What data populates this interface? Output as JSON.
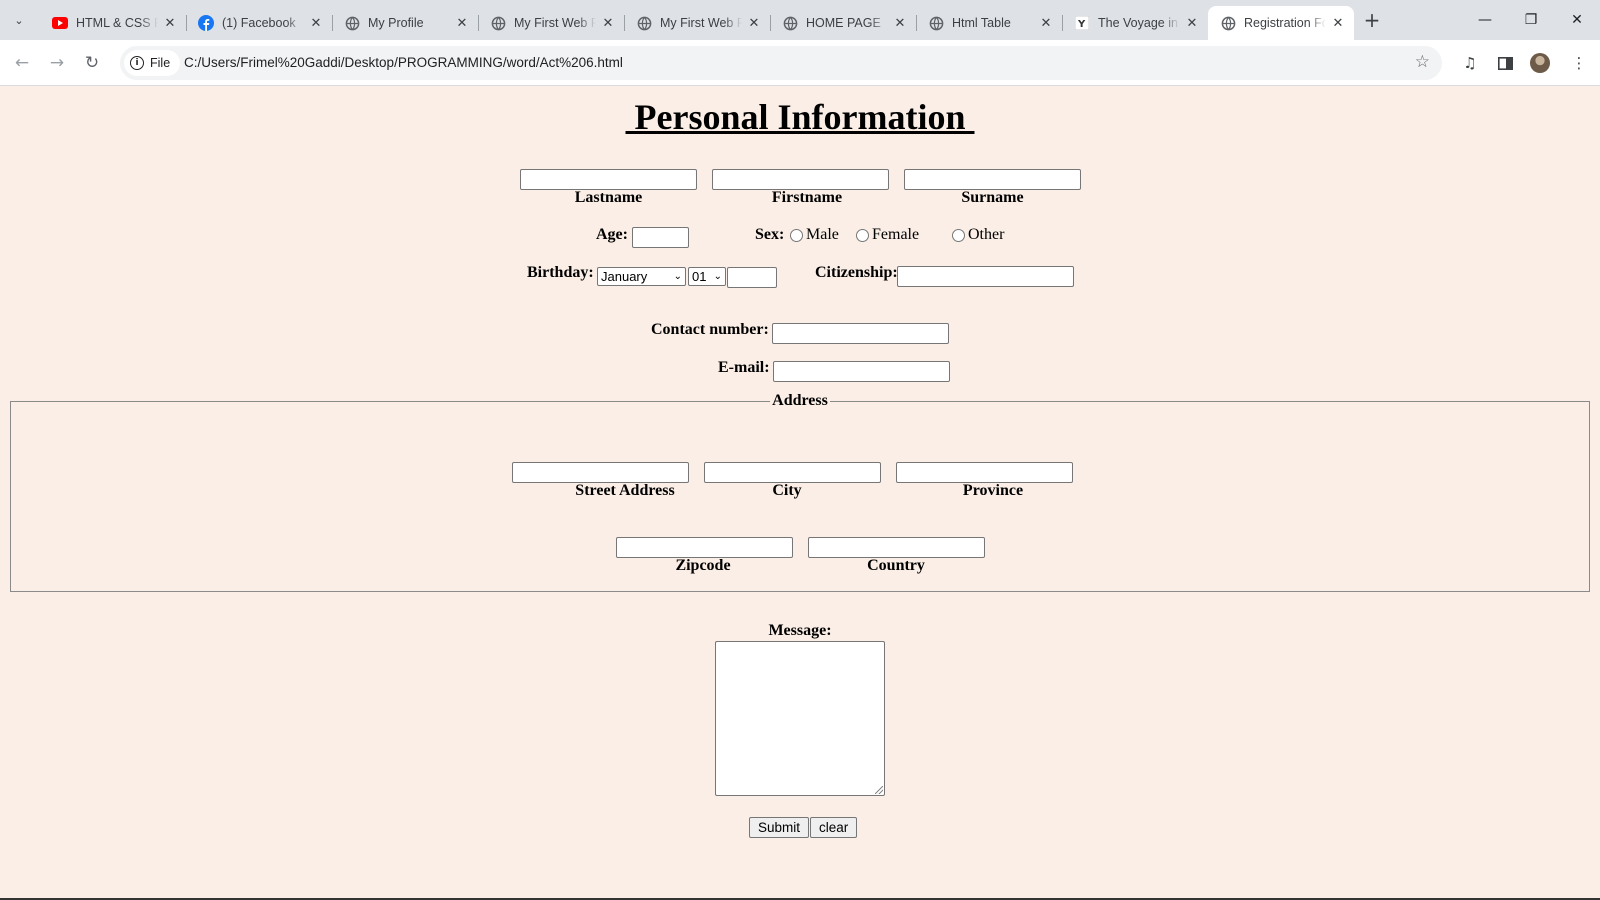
{
  "browser": {
    "tabs": [
      {
        "title": "HTML & CSS F",
        "favicon": "youtube-icon"
      },
      {
        "title": "(1) Facebook",
        "favicon": "facebook-icon"
      },
      {
        "title": "My Profile",
        "favicon": "globe-icon"
      },
      {
        "title": "My First Web F",
        "favicon": "globe-icon"
      },
      {
        "title": "My First Web F",
        "favicon": "globe-icon"
      },
      {
        "title": "HOME PAGE",
        "favicon": "globe-icon"
      },
      {
        "title": "Html Table",
        "favicon": "globe-icon"
      },
      {
        "title": "The Voyage in",
        "favicon": "y-icon"
      },
      {
        "title": "Registration Fo",
        "favicon": "globe-icon",
        "active": true
      }
    ],
    "close_glyph": "✕",
    "new_tab_glyph": "+",
    "address": {
      "chip_label": "File",
      "url": "C:/Users/Frimel%20Gaddi/Desktop/PROGRAMMING/word/Act%206.html"
    },
    "accent_color": "#1a73e8"
  },
  "page": {
    "title": " Personal Information ",
    "name_labels": {
      "lastname": "Lastname",
      "firstname": "Firstname",
      "surname": "Surname"
    },
    "age_label": "Age:",
    "sex_label": "Sex:",
    "sex_options": [
      "Male",
      "Female",
      "Other"
    ],
    "birthday_label": "Birthday:",
    "birth_month": "January",
    "birth_day": "01",
    "citizenship_label": "Citizenship:",
    "contact_label": "Contact number:",
    "email_label": "E-mail:",
    "address_legend": "Address",
    "address_labels": {
      "street": "Street Address",
      "city": "City",
      "province": "Province",
      "zipcode": "Zipcode",
      "country": "Country"
    },
    "message_label": "Message:",
    "submit_label": "Submit",
    "clear_label": "clear",
    "background_color": "#faeee6"
  }
}
